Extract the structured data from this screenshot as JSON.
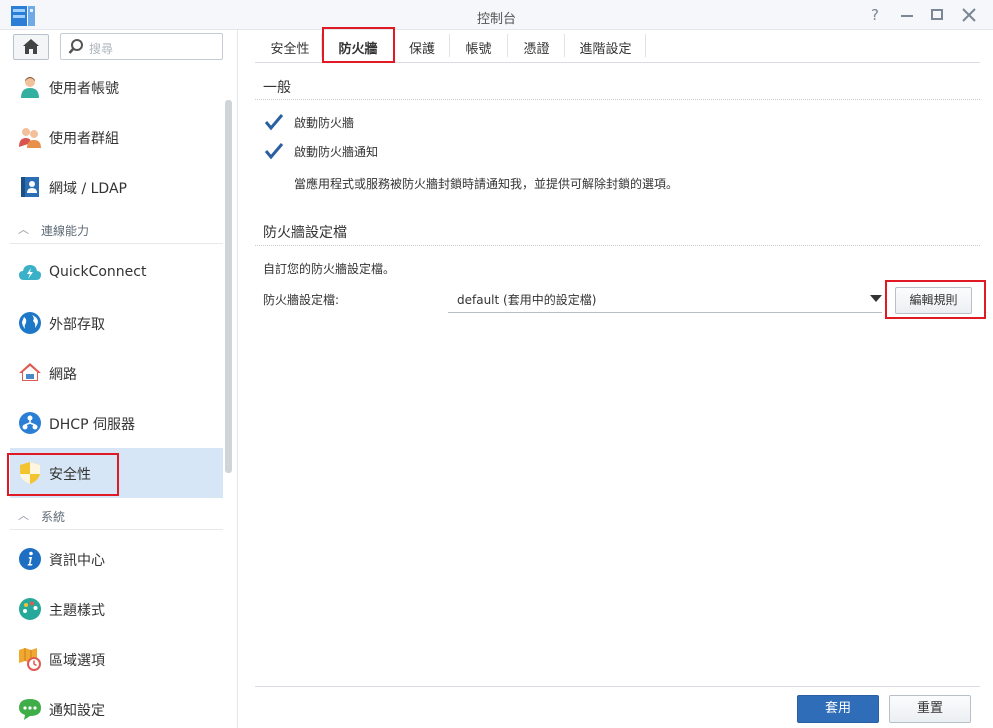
{
  "window": {
    "title": "控制台",
    "help_icon": "help-icon",
    "minimize_icon": "minimize-icon",
    "maximize_icon": "maximize-icon",
    "close_icon": "close-icon"
  },
  "search": {
    "placeholder": "搜尋"
  },
  "sidebar": {
    "items": [
      {
        "label": "使用者帳號",
        "icon": "user-icon"
      },
      {
        "label": "使用者群組",
        "icon": "user-group-icon"
      },
      {
        "label": "網域 / LDAP",
        "icon": "domain-ldap-icon"
      },
      {
        "label": "QuickConnect",
        "icon": "quickconnect-icon"
      },
      {
        "label": "外部存取",
        "icon": "external-access-icon"
      },
      {
        "label": "網路",
        "icon": "network-icon"
      },
      {
        "label": "DHCP 伺服器",
        "icon": "dhcp-server-icon"
      },
      {
        "label": "安全性",
        "icon": "security-shield-icon"
      },
      {
        "label": "資訊中心",
        "icon": "info-center-icon"
      },
      {
        "label": "主題樣式",
        "icon": "theme-icon"
      },
      {
        "label": "區域選項",
        "icon": "regional-options-icon"
      },
      {
        "label": "通知設定",
        "icon": "notification-icon"
      }
    ],
    "sections": [
      {
        "label": "連線能力"
      },
      {
        "label": "系統"
      }
    ],
    "active_item": "安全性"
  },
  "tabs": [
    {
      "label": "安全性"
    },
    {
      "label": "防火牆"
    },
    {
      "label": "保護"
    },
    {
      "label": "帳號"
    },
    {
      "label": "憑證"
    },
    {
      "label": "進階設定"
    }
  ],
  "active_tab": "防火牆",
  "general": {
    "title": "一般",
    "enable_firewall": {
      "label": "啟動防火牆",
      "checked": true
    },
    "enable_notify": {
      "label": "啟動防火牆通知",
      "checked": true
    },
    "notify_desc": "當應用程式或服務被防火牆封鎖時請通知我，並提供可解除封鎖的選項。"
  },
  "profile": {
    "title": "防火牆設定檔",
    "desc": "自訂您的防火牆設定檔。",
    "field_label": "防火牆設定檔:",
    "selected": "default (套用中的設定檔)",
    "edit_button": "編輯規則"
  },
  "footer": {
    "apply": "套用",
    "reset": "重置"
  },
  "colors": {
    "accent": "#2f6db9",
    "highlight_red": "#e01a24",
    "active_bg": "#d6e6f6"
  }
}
